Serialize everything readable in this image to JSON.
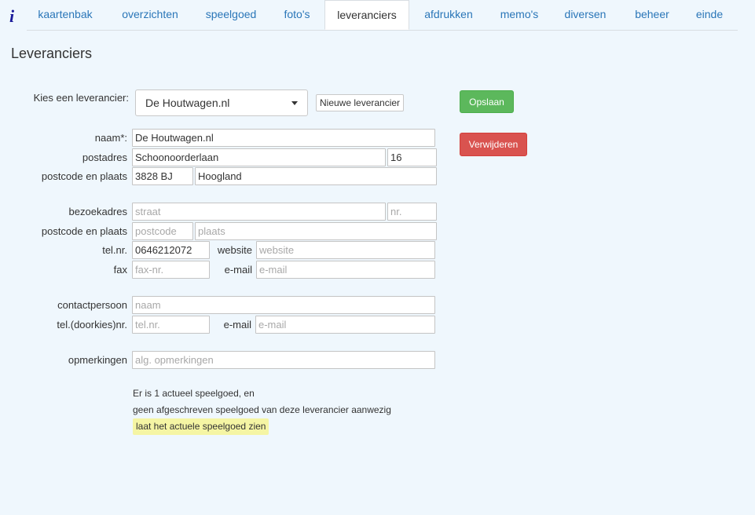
{
  "nav": {
    "logo": "i",
    "tabs": [
      {
        "label": "kaartenbak"
      },
      {
        "label": "overzichten"
      },
      {
        "label": "speelgoed"
      },
      {
        "label": "foto's"
      },
      {
        "label": "leveranciers"
      },
      {
        "label": "afdrukken"
      },
      {
        "label": "memo's"
      },
      {
        "label": "diversen"
      },
      {
        "label": "beheer"
      },
      {
        "label": "einde"
      }
    ],
    "active_tab": "leveranciers"
  },
  "page_title": "Leveranciers",
  "supplier_select": {
    "label": "Kies een leverancier:",
    "value": "De Houtwagen.nl",
    "new_button": "Nieuwe leverancier"
  },
  "actions": {
    "save": "Opslaan",
    "delete": "Verwijderen"
  },
  "form": {
    "naam": {
      "label": "naam*:",
      "value": "De Houtwagen.nl"
    },
    "postadres": {
      "label": "postadres",
      "street": "Schoonoorderlaan",
      "nr": "16"
    },
    "post_postcode": {
      "label": "postcode en plaats",
      "postcode": "3828 BJ",
      "plaats": "Hoogland"
    },
    "bezoekadres": {
      "label": "bezoekadres",
      "street_placeholder": "straat",
      "nr_placeholder": "nr."
    },
    "visit_postcode": {
      "label": "postcode en plaats",
      "postcode_placeholder": "postcode",
      "plaats_placeholder": "plaats"
    },
    "tel": {
      "label": "tel.nr.",
      "value": "0646212072"
    },
    "website": {
      "label": "website",
      "placeholder": "website"
    },
    "fax": {
      "label": "fax",
      "placeholder": "fax-nr."
    },
    "email": {
      "label": "e-mail",
      "placeholder": "e-mail"
    },
    "contactpersoon": {
      "label": "contactpersoon",
      "placeholder": "naam"
    },
    "contact_tel": {
      "label": "tel.(doorkies)nr.",
      "placeholder": "tel.nr."
    },
    "contact_email": {
      "label": "e-mail",
      "placeholder": "e-mail"
    },
    "opmerkingen": {
      "label": "opmerkingen",
      "placeholder": "alg. opmerkingen"
    }
  },
  "info": {
    "line1": "Er is 1 actueel speelgoed, en",
    "line2": "geen afgeschreven speelgoed van deze leverancier aanwezig",
    "link": "laat het actuele speelgoed zien"
  },
  "colors": {
    "background": "#eff7fd",
    "tab_text": "#2a76b8",
    "save": "#5cb85c",
    "delete": "#d9534f",
    "highlight": "#f5f5a4"
  }
}
